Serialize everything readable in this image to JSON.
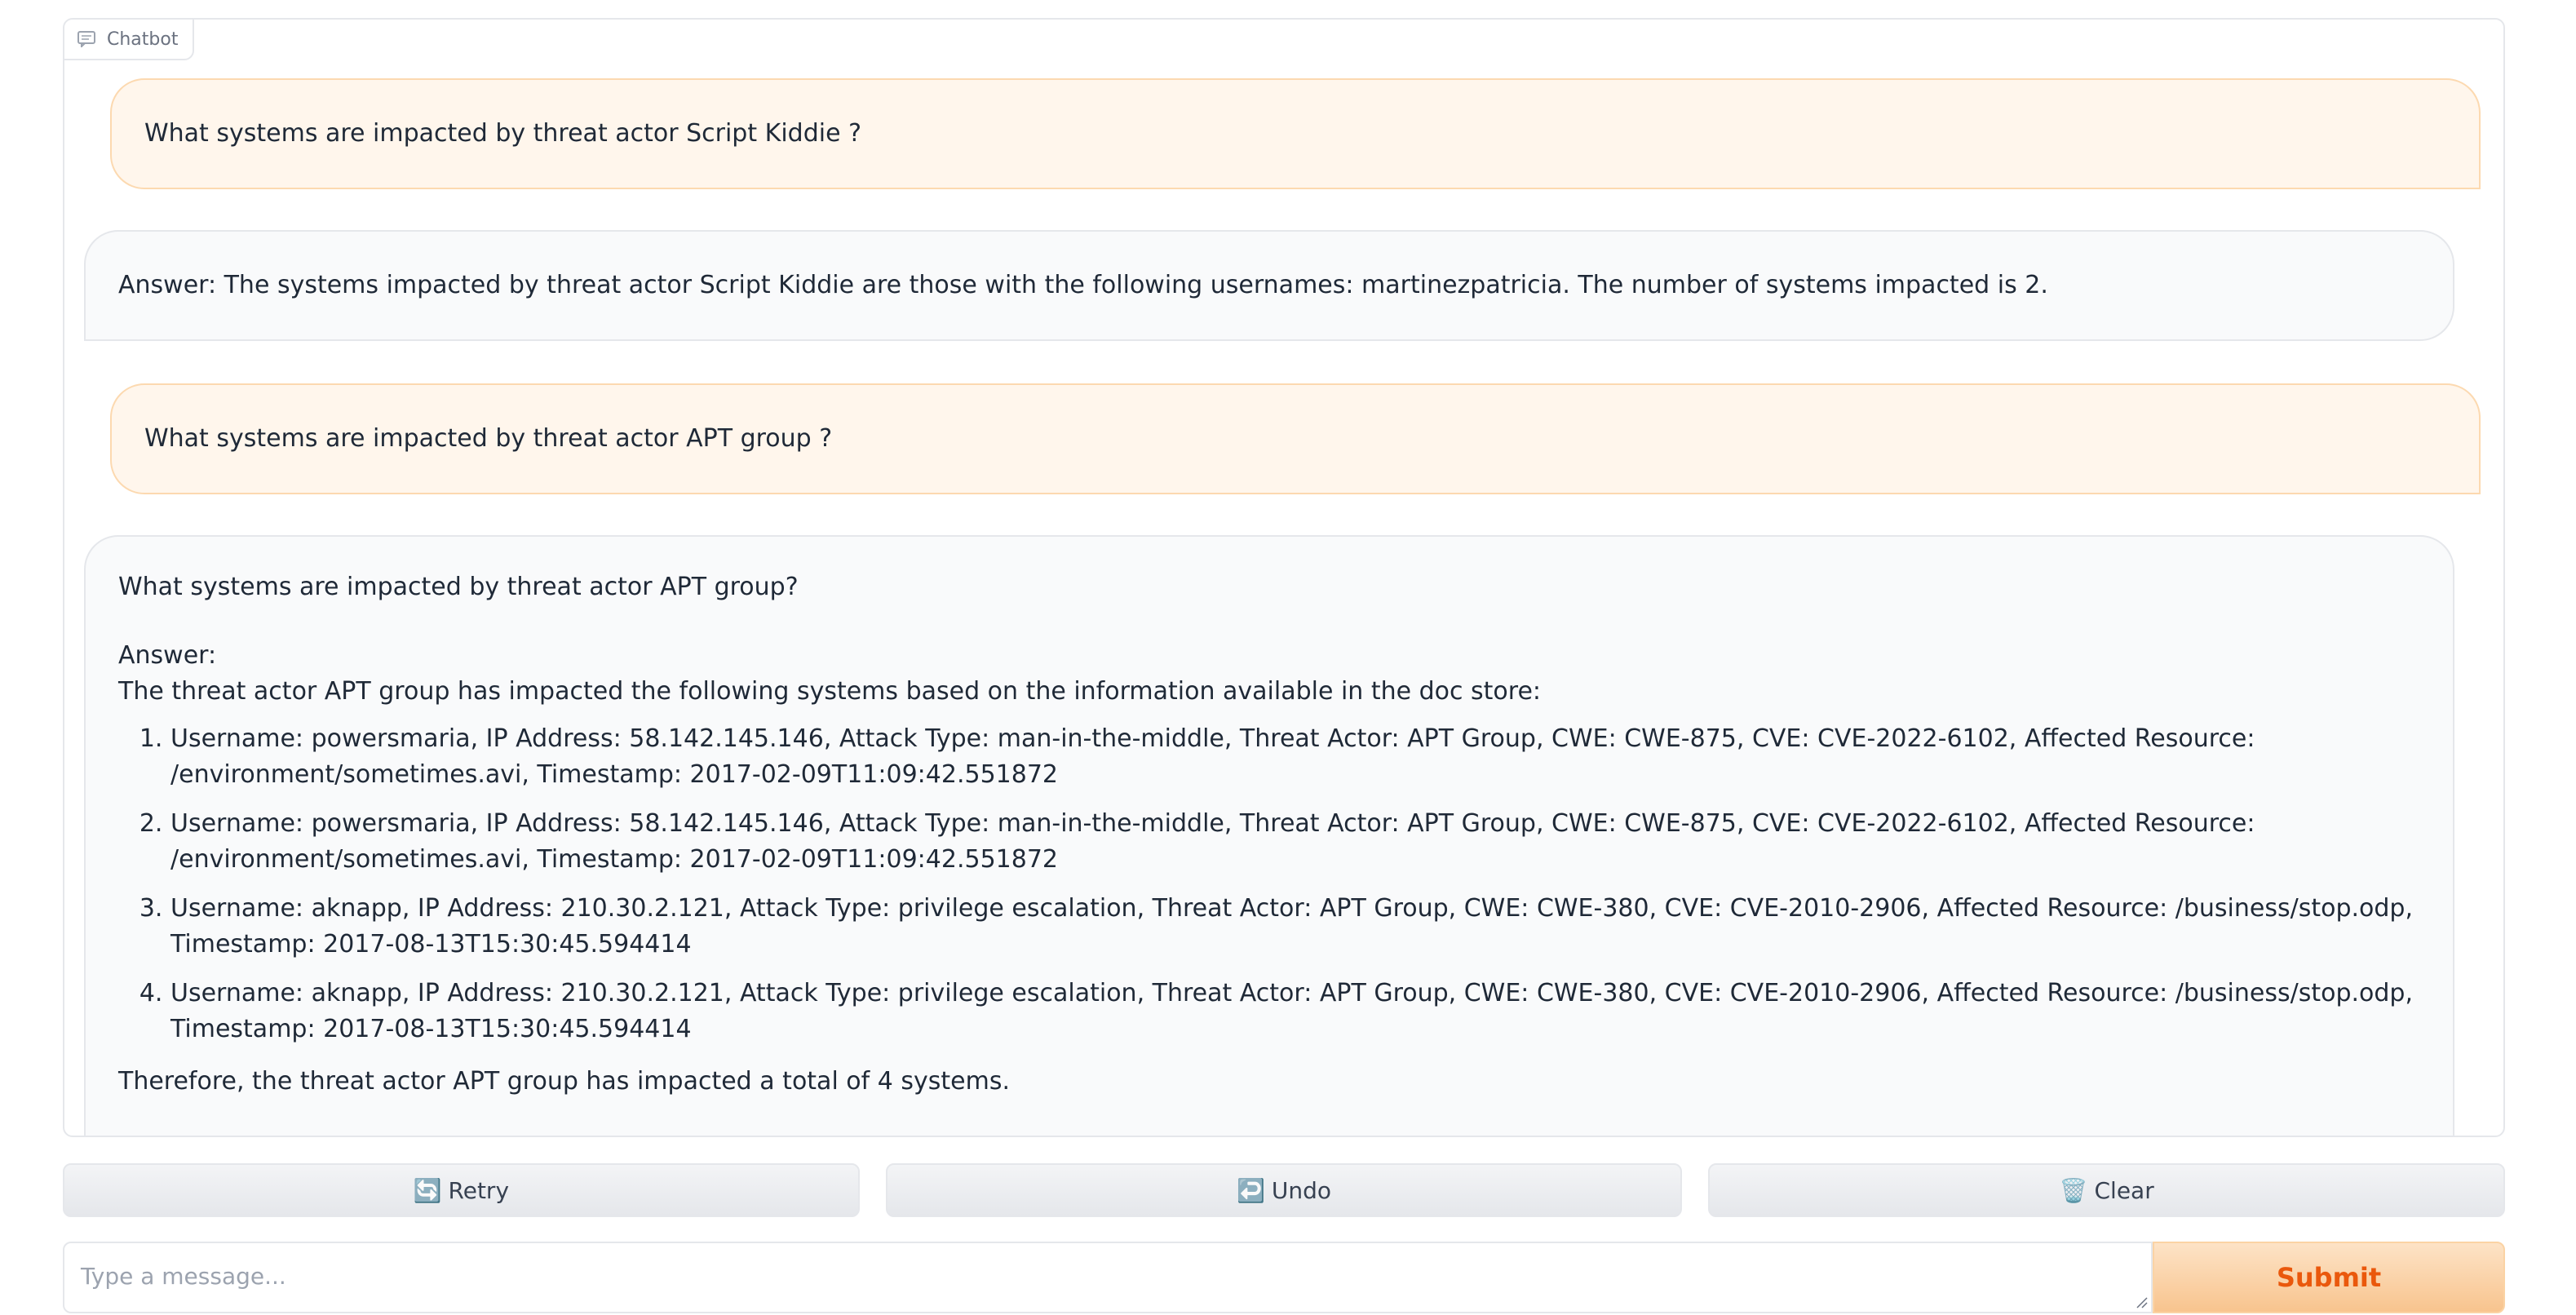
{
  "chatbot": {
    "label": "Chatbot",
    "label_icon": "chat-bubble-icon",
    "messages": [
      {
        "role": "user",
        "text": "What systems are impacted by threat actor Script Kiddie ?"
      },
      {
        "role": "bot",
        "text": "Answer: The systems impacted by threat actor Script Kiddie are those with the following usernames: martinezpatricia. The number of systems impacted is 2."
      },
      {
        "role": "user",
        "text": "What systems are impacted by threat actor APT group ?"
      },
      {
        "role": "bot",
        "question": "What systems are impacted by threat actor APT group?",
        "answer_label": "Answer:",
        "intro": "The threat actor APT group has impacted the following systems based on the information available in the doc store:",
        "items": [
          "Username: powersmaria, IP Address: 58.142.145.146, Attack Type: man-in-the-middle, Threat Actor: APT Group, CWE: CWE-875, CVE: CVE-2022-6102, Affected Resource: /environment/sometimes.avi, Timestamp: 2017-02-09T11:09:42.551872",
          "Username: powersmaria, IP Address: 58.142.145.146, Attack Type: man-in-the-middle, Threat Actor: APT Group, CWE: CWE-875, CVE: CVE-2022-6102, Affected Resource: /environment/sometimes.avi, Timestamp: 2017-02-09T11:09:42.551872",
          "Username: aknapp, IP Address: 210.30.2.121, Attack Type: privilege escalation, Threat Actor: APT Group, CWE: CWE-380, CVE: CVE-2010-2906, Affected Resource: /business/stop.odp, Timestamp: 2017-08-13T15:30:45.594414",
          "Username: aknapp, IP Address: 210.30.2.121, Attack Type: privilege escalation, Threat Actor: APT Group, CWE: CWE-380, CVE: CVE-2010-2906, Affected Resource: /business/stop.odp, Timestamp: 2017-08-13T15:30:45.594414"
        ],
        "conclusion": "Therefore, the threat actor APT group has impacted a total of 4 systems."
      }
    ]
  },
  "buttons": {
    "retry": {
      "icon": "🔄",
      "icon_name": "retry-icon",
      "label": "Retry"
    },
    "undo": {
      "icon": "↩️",
      "icon_name": "undo-icon",
      "label": "Undo"
    },
    "clear": {
      "icon": "🗑️",
      "icon_name": "trash-icon",
      "label": "Clear"
    }
  },
  "input": {
    "placeholder": "Type a message...",
    "value": ""
  },
  "submit": {
    "label": "Submit"
  },
  "colors": {
    "user_bubble_bg": "#fff6ec",
    "user_bubble_border": "#fcd9b0",
    "bot_bubble_bg": "#f9fafb",
    "submit_text": "#ea580c"
  }
}
